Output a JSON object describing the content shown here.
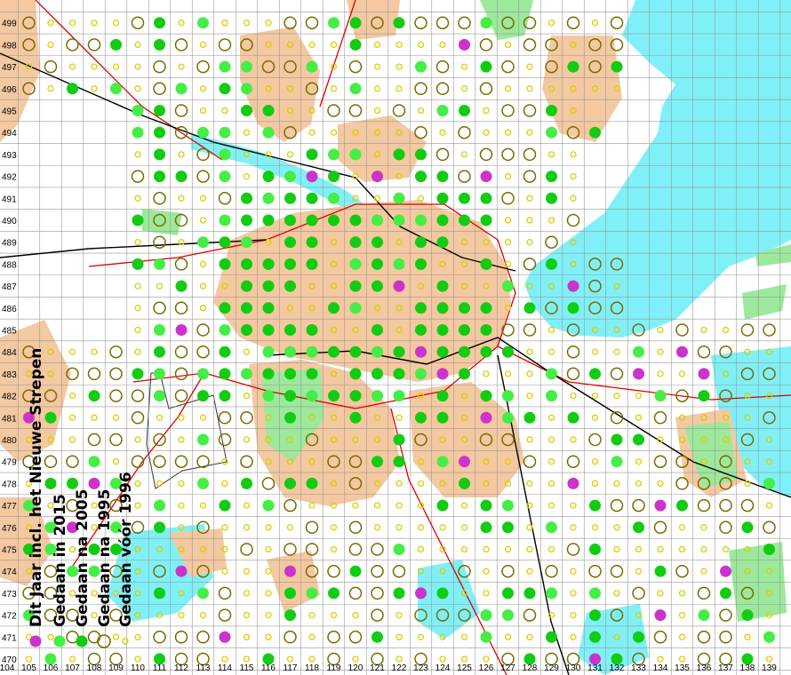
{
  "map": {
    "x_axis_labels": [
      "104",
      "105",
      "106",
      "107",
      "108",
      "109",
      "110",
      "111",
      "112",
      "113",
      "114",
      "115",
      "116",
      "117",
      "118",
      "119",
      "120",
      "121",
      "122",
      "123",
      "124",
      "125",
      "126",
      "127",
      "128",
      "129",
      "130",
      "131",
      "132",
      "133",
      "134",
      "135",
      "136",
      "137",
      "138",
      "139"
    ],
    "y_axis_labels": [
      "470",
      "471",
      "472",
      "473",
      "474",
      "475",
      "476",
      "477",
      "478",
      "479",
      "480",
      "481",
      "482",
      "483",
      "484",
      "485",
      "486",
      "487",
      "488",
      "489",
      "490",
      "491",
      "492",
      "493",
      "494",
      "495",
      "496",
      "497",
      "498",
      "499"
    ],
    "legend": [
      {
        "label": "Dit Jaar incl. het Nieuwe Strepen",
        "symbol": "magenta-dot",
        "color": "#cc33cc"
      },
      {
        "label": "Gedaan in 2015",
        "symbol": "lightgreen-dot",
        "color": "#44ee44"
      },
      {
        "label": "Gedaan na 2005",
        "symbol": "green-dot",
        "color": "#11cc11"
      },
      {
        "label": "Gedaan na 1995",
        "symbol": "large-ring",
        "color": "#7a6a00"
      },
      {
        "label": "Gedaan vóór 1996",
        "symbol": "small-ring",
        "color": "#d8d000"
      }
    ],
    "colors": {
      "grid": "#999999",
      "water": "#80f0f8",
      "urban": "#f4c8a0",
      "park": "#9ce89c",
      "rail": "#000000",
      "road": "#dd0000"
    }
  }
}
